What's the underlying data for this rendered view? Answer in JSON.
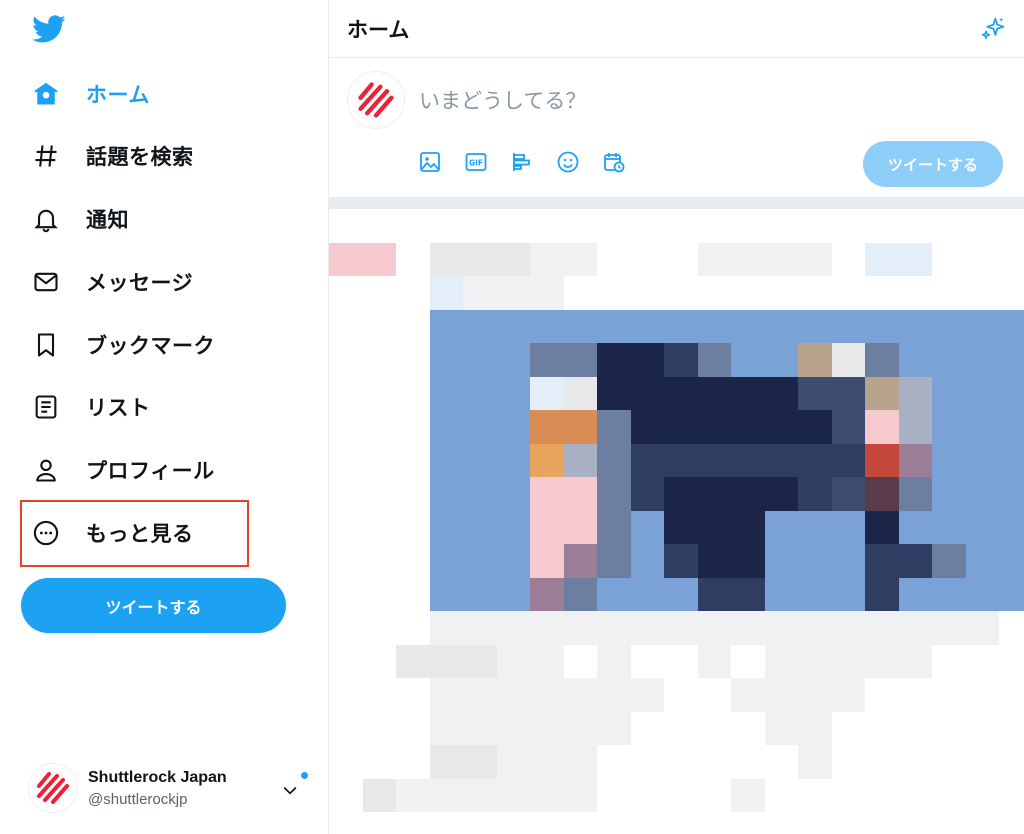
{
  "sidebar": {
    "nav": [
      {
        "label": "ホーム",
        "icon": "home-icon",
        "active": true
      },
      {
        "label": "話題を検索",
        "icon": "hashtag-icon",
        "active": false
      },
      {
        "label": "通知",
        "icon": "bell-icon",
        "active": false
      },
      {
        "label": "メッセージ",
        "icon": "envelope-icon",
        "active": false
      },
      {
        "label": "ブックマーク",
        "icon": "bookmark-icon",
        "active": false
      },
      {
        "label": "リスト",
        "icon": "list-icon",
        "active": false
      },
      {
        "label": "プロフィール",
        "icon": "person-icon",
        "active": false
      },
      {
        "label": "もっと見る",
        "icon": "more-circle-icon",
        "active": false
      }
    ],
    "tweet_button": "ツイートする",
    "account": {
      "name": "Shuttlerock Japan",
      "handle": "@shuttlerockjp"
    }
  },
  "main": {
    "title": "ホーム",
    "compose": {
      "placeholder": "いまどうしてる？",
      "tools": [
        "image-icon",
        "gif-icon",
        "poll-icon",
        "emoji-icon",
        "schedule-icon"
      ],
      "tweet_button": "ツイートする"
    }
  },
  "colors": {
    "accent": "#1da1f2",
    "highlight": "#e8402b",
    "brand_red": "#e8233a"
  }
}
